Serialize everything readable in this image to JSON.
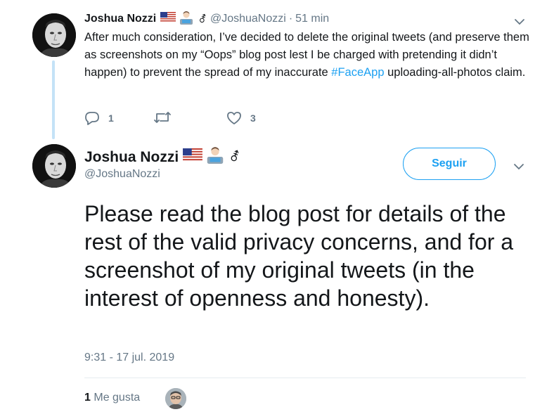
{
  "reply_tweet": {
    "name": "Joshua Nozzi",
    "handle": "@JoshuaNozzi",
    "separator": "·",
    "time": "51 min",
    "text_before": "After much consideration, I’ve decided to delete the original tweets (and preserve them as screenshots on my “Oops” blog post lest I be charged with pretending it didn’t happen) to prevent the spread of my inaccurate ",
    "hashtag": "#FaceApp",
    "text_after": " uploading-all-photos claim.",
    "reply_count": "1",
    "retweet_count": "",
    "like_count": "3",
    "icons": [
      "flag-us-icon",
      "technologist-icon",
      "gender-symbol-icon",
      "chevron-down-icon",
      "reply-icon",
      "retweet-icon",
      "heart-icon"
    ]
  },
  "main_tweet": {
    "name": "Joshua Nozzi",
    "handle": "@JoshuaNozzi",
    "follow_label": "Seguir",
    "text": "Please read the blog post for details of the rest of the valid privacy concerns, and for a screenshot of my original tweets (in the interest of openness and honesty).",
    "timestamp": "9:31 - 17 jul. 2019",
    "likes_count": "1",
    "likes_label": "Me gusta"
  },
  "colors": {
    "accent": "#1da1f2",
    "secondary_text": "#657786",
    "thread_line": "#c4e2f7",
    "primary_text": "#14171a"
  },
  "gender_symbol": "⚦"
}
